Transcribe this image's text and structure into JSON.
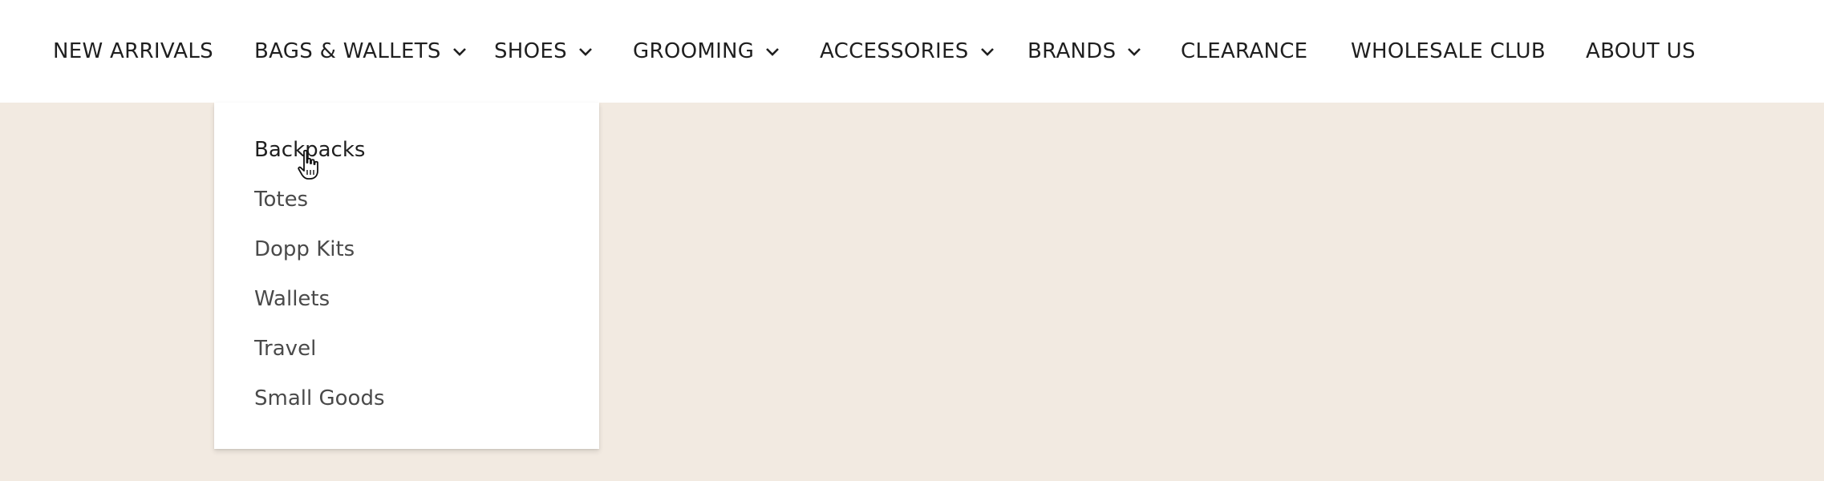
{
  "nav": {
    "items": [
      {
        "label": "NEW ARRIVALS",
        "has_dropdown": false
      },
      {
        "label": "BAGS & WALLETS",
        "has_dropdown": true
      },
      {
        "label": "SHOES",
        "has_dropdown": true
      },
      {
        "label": "GROOMING",
        "has_dropdown": true
      },
      {
        "label": "ACCESSORIES",
        "has_dropdown": true
      },
      {
        "label": "BRANDS",
        "has_dropdown": true
      },
      {
        "label": "CLEARANCE",
        "has_dropdown": false
      },
      {
        "label": "WHOLESALE CLUB",
        "has_dropdown": false
      },
      {
        "label": "ABOUT US",
        "has_dropdown": false
      }
    ]
  },
  "dropdown": {
    "parent": "BAGS & WALLETS",
    "items": [
      {
        "label": "Backpacks"
      },
      {
        "label": "Totes"
      },
      {
        "label": "Dopp Kits"
      },
      {
        "label": "Wallets"
      },
      {
        "label": "Travel"
      },
      {
        "label": "Small Goods"
      }
    ]
  },
  "colors": {
    "page_background": "#f2eae1",
    "nav_background": "#ffffff",
    "nav_text": "#1f1f1f",
    "dropdown_text": "#4a4a4a"
  },
  "icons": {
    "chevron": "chevron-down-icon",
    "cursor": "hand-pointer-cursor"
  }
}
